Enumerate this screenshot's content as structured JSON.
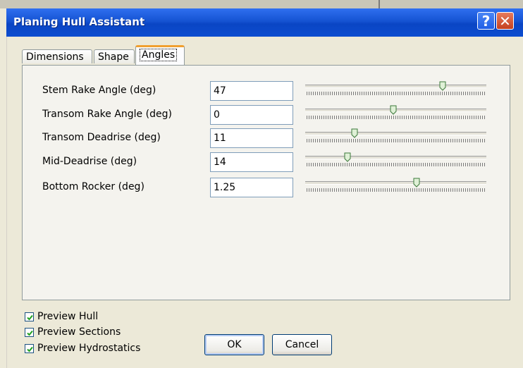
{
  "window": {
    "title": "Planing Hull Assistant",
    "help_glyph": "?",
    "close_glyph": "✕"
  },
  "tabs": [
    {
      "label": "Dimensions"
    },
    {
      "label": "Shape"
    },
    {
      "label": "Angles",
      "active": true
    }
  ],
  "fields": [
    {
      "label": "Stem Rake Angle (deg)",
      "value": "47",
      "slider_fraction": 0.78
    },
    {
      "label": "Transom Rake Angle (deg)",
      "value": "0",
      "slider_fraction": 0.5
    },
    {
      "label": "Transom Deadrise (deg)",
      "value": "11",
      "slider_fraction": 0.28
    },
    {
      "label": "Mid-Deadrise (deg)",
      "value": "14",
      "slider_fraction": 0.24
    },
    {
      "label": "Bottom Rocker (deg)",
      "value": "1.25",
      "slider_fraction": 0.63
    }
  ],
  "options": [
    {
      "label": "Preview Hull",
      "checked": true
    },
    {
      "label": "Preview Sections",
      "checked": true
    },
    {
      "label": "Preview Hydrostatics",
      "checked": true
    }
  ],
  "buttons": {
    "ok": "OK",
    "cancel": "Cancel"
  }
}
